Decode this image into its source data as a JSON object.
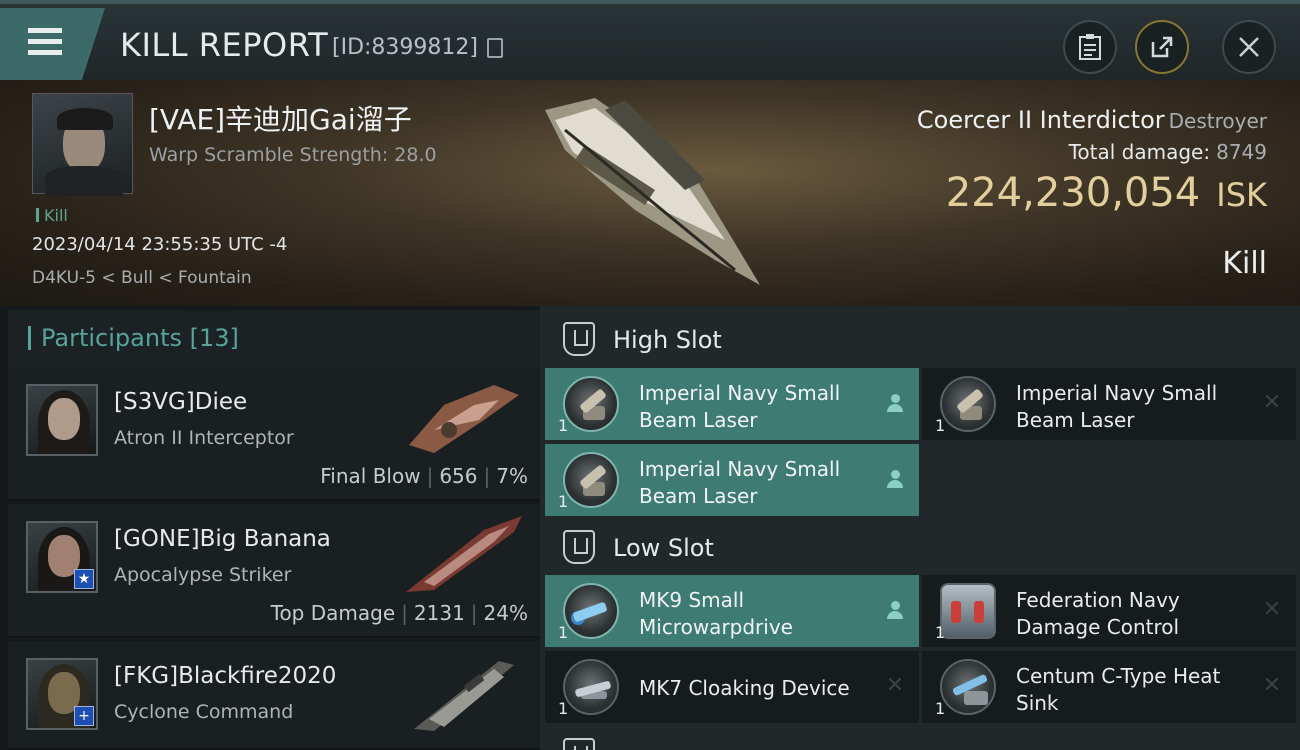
{
  "header": {
    "title": "KILL REPORT",
    "report_id": "[ID:8399812]"
  },
  "victim": {
    "name": "[VAE]辛迪加Gai溜子",
    "warp_scramble": "Warp Scramble Strength: 28.0",
    "tag": "Kill",
    "timestamp": "2023/04/14 23:55:35 UTC -4",
    "location": "D4KU-5 < Bull < Fountain",
    "ship": "Coercer II Interdictor",
    "ship_class": "Destroyer",
    "total_damage_label": "Total damage:",
    "total_damage": "8749",
    "isk_value": "224,230,054",
    "isk_unit": "ISK",
    "result": "Kill"
  },
  "participants": {
    "label": "Participants",
    "count": "[13]",
    "rows": [
      {
        "name": "[S3VG]Diee",
        "ship": "Atron II Interceptor",
        "role": "Final Blow",
        "damage": "656",
        "percent": "7%"
      },
      {
        "name": "[GONE]Big Banana",
        "ship": "Apocalypse Striker",
        "role": "Top Damage",
        "damage": "2131",
        "percent": "24%"
      },
      {
        "name": "[FKG]Blackfire2020",
        "ship": "Cyclone Command"
      }
    ]
  },
  "fitting": {
    "high_slot": {
      "title": "High Slot",
      "modules": [
        {
          "name": "Imperial Navy Small Beam Laser",
          "qty": "1",
          "status": "pilot"
        },
        {
          "name": "Imperial Navy Small Beam Laser",
          "qty": "1",
          "status": "destroyed"
        },
        {
          "name": "Imperial Navy Small Beam Laser",
          "qty": "1",
          "status": "pilot"
        }
      ]
    },
    "low_slot": {
      "title": "Low Slot",
      "modules": [
        {
          "name": "MK9 Small Microwarpdrive",
          "qty": "1",
          "status": "pilot"
        },
        {
          "name": "Federation Navy Damage Control",
          "qty": "1",
          "status": "destroyed"
        },
        {
          "name": "MK7 Cloaking Device",
          "qty": "1",
          "status": "destroyed"
        },
        {
          "name": "Centum C-Type Heat Sink",
          "qty": "1",
          "status": "destroyed"
        }
      ]
    }
  },
  "colors": {
    "accent": "#56a39a",
    "active_module": "#3e7c73",
    "isk": "#e3cf9c"
  }
}
